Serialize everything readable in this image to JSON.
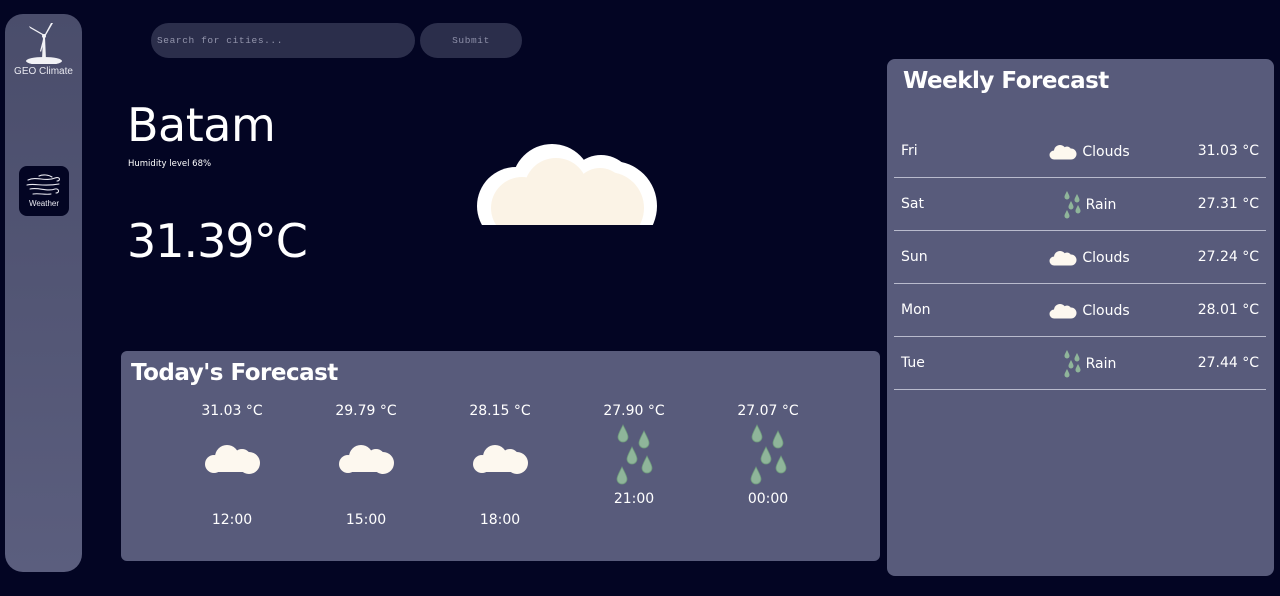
{
  "app": {
    "brand": "GEO Climate",
    "nav": [
      {
        "label": "Weather",
        "icon": "wind-icon"
      }
    ]
  },
  "search": {
    "placeholder": "Search for cities...",
    "submit_label": "Submit"
  },
  "current": {
    "city": "Batam",
    "humidity": "Humidity level 68%",
    "temperature": "31.39°C",
    "condition_icon": "cloud-icon"
  },
  "today": {
    "title": "Today's Forecast",
    "hours": [
      {
        "temp": "31.03 °C",
        "time": "12:00",
        "icon": "cloud-icon"
      },
      {
        "temp": "29.79 °C",
        "time": "15:00",
        "icon": "cloud-icon"
      },
      {
        "temp": "28.15 °C",
        "time": "18:00",
        "icon": "cloud-icon"
      },
      {
        "temp": "27.90 °C",
        "time": "21:00",
        "icon": "rain-icon"
      },
      {
        "temp": "27.07 °C",
        "time": "00:00",
        "icon": "rain-icon"
      }
    ]
  },
  "weekly": {
    "title": "Weekly Forecast",
    "days": [
      {
        "day": "Fri",
        "condition": "Clouds",
        "temp": "31.03 °C",
        "icon": "cloud-icon"
      },
      {
        "day": "Sat",
        "condition": "Rain",
        "temp": "27.31 °C",
        "icon": "rain-icon"
      },
      {
        "day": "Sun",
        "condition": "Clouds",
        "temp": "27.24 °C",
        "icon": "cloud-icon"
      },
      {
        "day": "Mon",
        "condition": "Clouds",
        "temp": "28.01 °C",
        "icon": "cloud-icon"
      },
      {
        "day": "Tue",
        "condition": "Rain",
        "temp": "27.44 °C",
        "icon": "rain-icon"
      }
    ]
  },
  "colors": {
    "background": "#030523",
    "panel": "#585b7b",
    "input": "#2b2e4b",
    "cloud": "#fdf8ef",
    "rain_drop": "#8fb59a"
  }
}
